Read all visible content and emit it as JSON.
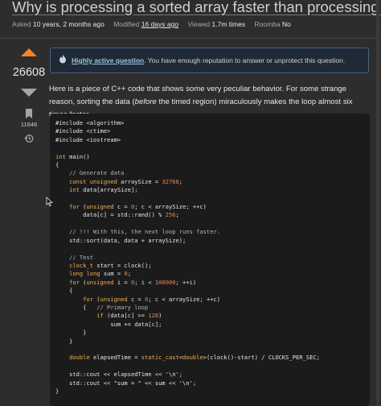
{
  "question": {
    "title": "Why is processing a sorted array faster than processing an unsorted array?",
    "meta": [
      {
        "label": "Asked",
        "value": "10 years, 2 months ago"
      },
      {
        "label": "Modified",
        "value": "16 days ago"
      },
      {
        "label": "Viewed",
        "value": "1.7m times"
      },
      {
        "label": "Roomba",
        "value": "No"
      }
    ],
    "score": "26608",
    "bookmarks": "11646",
    "notice_link": "Highly active question",
    "notice_text": ". You have enough reputation to answer or unprotect this question.",
    "body_parts": [
      "Here is a piece of C++ code that shows some very peculiar behavior. For some strange reason, sorting the data (",
      "before",
      " the timed region) miraculously makes the loop almost six times faster."
    ],
    "code_lines": [
      "#include <algorithm>",
      "#include <ctime>",
      "#include <iostream>",
      "",
      "int main()",
      "{",
      "    // Generate data",
      "    const unsigned arraySize = 32768;",
      "    int data[arraySize];",
      "",
      "    for (unsigned c = 0; c < arraySize; ++c)",
      "        data[c] = std::rand() % 256;",
      "",
      "    // !!! With this, the next loop runs faster.",
      "    std::sort(data, data + arraySize);",
      "",
      "    // Test",
      "    clock_t start = clock();",
      "    long long sum = 0;",
      "    for (unsigned i = 0; i < 100000; ++i)",
      "    {",
      "        for (unsigned c = 0; c < arraySize; ++c)",
      "        {   // Primary loop",
      "            if (data[c] >= 128)",
      "                sum += data[c];",
      "        }",
      "    }",
      "",
      "    double elapsedTime = static_cast<double>(clock()-start) / CLOCKS_PER_SEC;",
      "",
      "    std::cout << elapsedTime << '\\n';",
      "    std::cout << \"sum = \" << sum << '\\n';",
      "}"
    ]
  },
  "colors": {
    "accent": "#f48225",
    "notice_border": "#49617a",
    "link": "#9cc3db"
  }
}
